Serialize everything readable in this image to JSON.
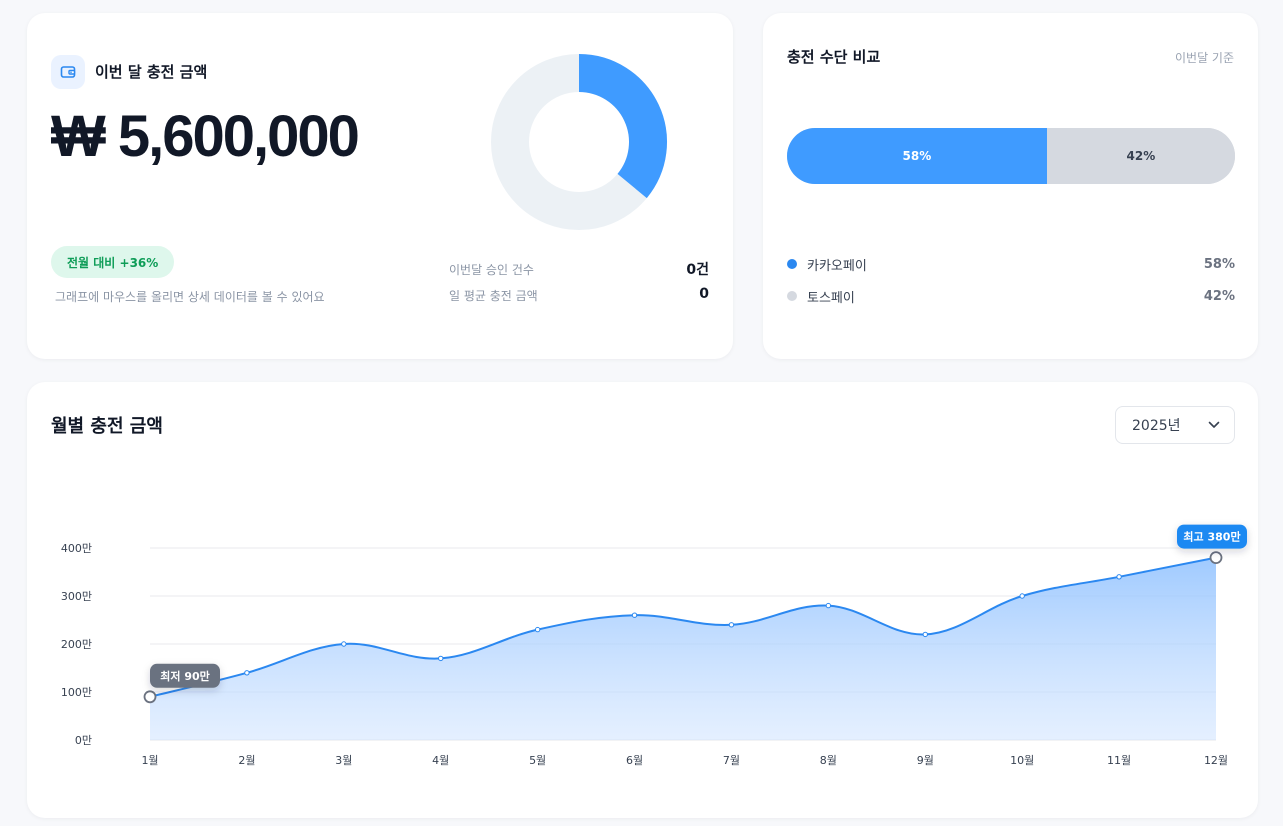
{
  "summary": {
    "title": "이번 달 충전 금액",
    "amount": "₩ 5,600,000",
    "delta_badge": "전월 대비 +36%",
    "hint": "그래프에 마우스를 올리면 상세 데이터를 볼 수 있어요",
    "stats": [
      {
        "label": "이번달 승인 건수",
        "value": "0건"
      },
      {
        "label": "일 평균 충전 금액",
        "value": "0"
      }
    ],
    "donut": {
      "filled_fraction": 0.36,
      "fill_color": "#3f9bff",
      "track_color": "#ecf1f5"
    }
  },
  "compare": {
    "title": "충전 수단 비교",
    "note": "이번달 기준",
    "items": [
      {
        "name": "카카오페이",
        "percent": 58,
        "label": "58%",
        "color": "#3f9bff"
      },
      {
        "name": "토스페이",
        "percent": 42,
        "label": "42%",
        "color": "#d5d9e0"
      }
    ]
  },
  "monthly": {
    "title": "월별 충전 금액",
    "year_select": "2025년"
  },
  "chart_data": {
    "type": "area",
    "categories": [
      "1월",
      "2월",
      "3월",
      "4월",
      "5월",
      "6월",
      "7월",
      "8월",
      "9월",
      "10월",
      "11월",
      "12월"
    ],
    "values": [
      90,
      140,
      200,
      170,
      230,
      260,
      240,
      280,
      220,
      300,
      340,
      380
    ],
    "y_ticks": [
      "0만",
      "100만",
      "200만",
      "300만",
      "400만"
    ],
    "y_tick_values": [
      0,
      100,
      200,
      300,
      400
    ],
    "ylim": [
      0,
      400
    ],
    "grid": true,
    "line_color": "#2b88f0",
    "min_label": "최저 90만",
    "max_label": "최고 380만"
  }
}
